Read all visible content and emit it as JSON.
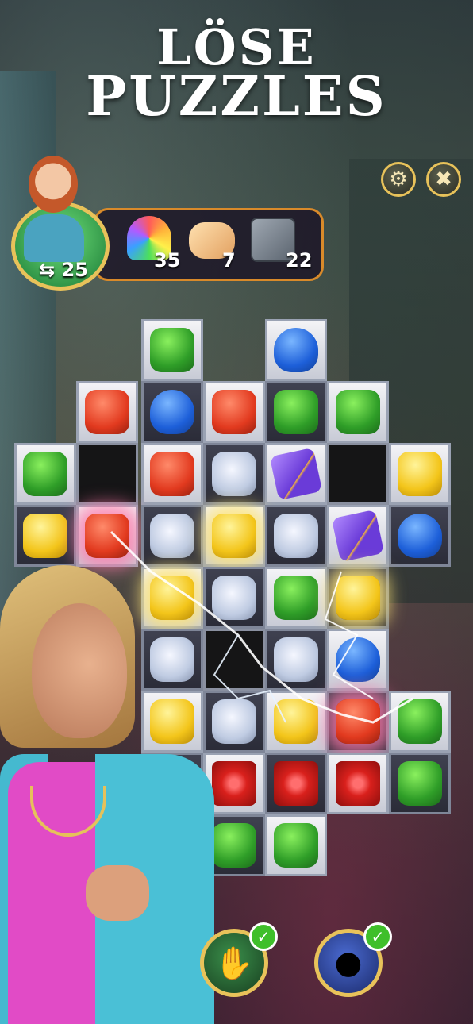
{
  "title": {
    "line1": "LÖSE",
    "line2": "PUZZLES"
  },
  "hud": {
    "settings_icon": "gear-icon",
    "close_icon": "close-icon",
    "moves": "25",
    "moves_icon": "swap-arrows-icon"
  },
  "goals": [
    {
      "name": "rainbow-cupcake",
      "count": "35"
    },
    {
      "name": "scroll",
      "count": "7"
    },
    {
      "name": "stone-block",
      "count": "22"
    }
  ],
  "boosters": [
    {
      "name": "hand-booster",
      "checked": true
    },
    {
      "name": "bomb-booster",
      "checked": true
    }
  ],
  "colors": {
    "frame_gold": "#e8c25a",
    "panel_orange": "#d98a2a",
    "check_green": "#3fbf2a"
  }
}
